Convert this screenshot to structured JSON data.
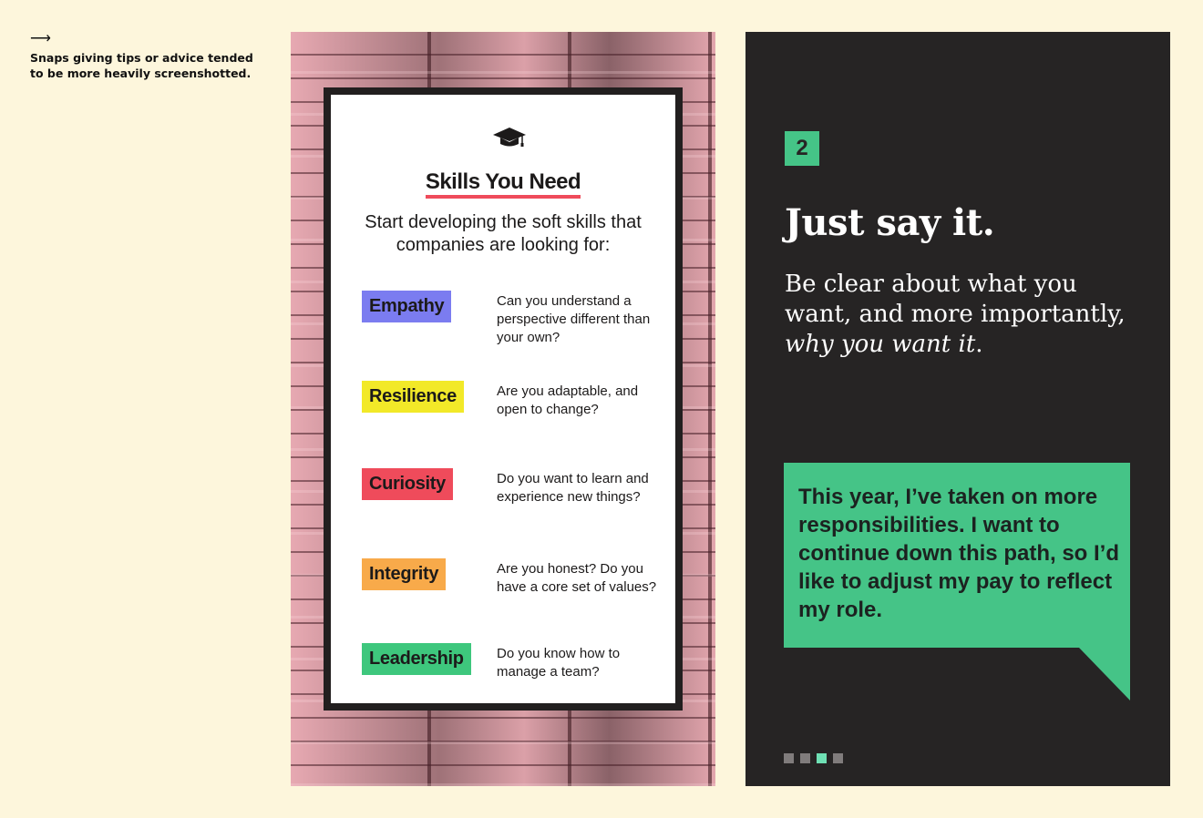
{
  "caption": {
    "arrow": "⟶",
    "text": "Snaps giving tips or advice tended to be more heavily screenshotted."
  },
  "left_card": {
    "icon": "graduation-cap-icon",
    "title": "Skills You Need",
    "subtitle": "Start developing the soft skills that companies are looking for:",
    "skills": [
      {
        "name": "Empathy",
        "color": "#7b7cf0",
        "desc": "Can you understand a perspective different than your own?"
      },
      {
        "name": "Resilience",
        "color": "#f2e928",
        "desc": "Are you adaptable, and open to change?"
      },
      {
        "name": "Curiosity",
        "color": "#ef4b5b",
        "desc": "Do you want to learn and experience new things?"
      },
      {
        "name": "Integrity",
        "color": "#f8aa4a",
        "desc": "Are you honest? Do you have a core set of values?"
      },
      {
        "name": "Leadership",
        "color": "#3ec77d",
        "desc": "Do you know how to manage a team?"
      }
    ]
  },
  "right_card": {
    "number": "2",
    "headline": "Just say it.",
    "body_plain": "Be clear about what you want, and more importantly, ",
    "body_italic": "why you want it",
    "body_end": ".",
    "quote": "This year, I’ve taken on more responsibilities. I want to continue down this path, so I’d like to adjust my pay to reflect my role.",
    "pagination": {
      "total": 4,
      "active_index": 2
    },
    "accent_color": "#45c487"
  }
}
